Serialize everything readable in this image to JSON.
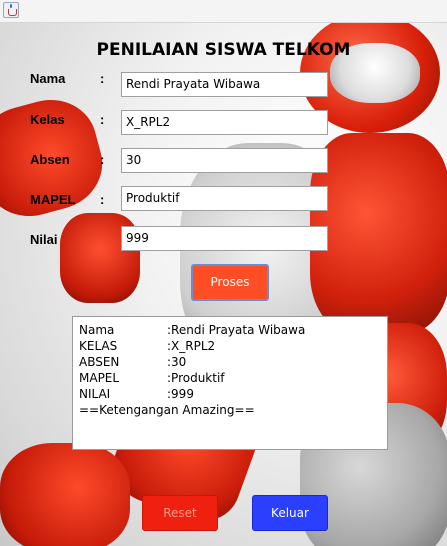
{
  "window": {
    "icon": "java-cup-icon"
  },
  "form": {
    "title": "PENILAIAN SISWA TELKOM",
    "fields": [
      {
        "label": "Nama",
        "colon": ":",
        "value": "Rendi Prayata Wibawa"
      },
      {
        "label": "Kelas",
        "colon": ":",
        "value": "X_RPL2"
      },
      {
        "label": "Absen",
        "colon": ":",
        "value": "30"
      },
      {
        "label": "MAPEL",
        "colon": ":",
        "value": "Produktif"
      },
      {
        "label": "Nilai",
        "colon": "",
        "value": "999"
      }
    ]
  },
  "buttons": {
    "proses": "Proses",
    "reset": "Reset",
    "keluar": "Keluar"
  },
  "output": {
    "rows": [
      {
        "key": "Nama",
        "value": ":Rendi Prayata Wibawa"
      },
      {
        "key": "KELAS",
        "value": ":X_RPL2"
      },
      {
        "key": "ABSEN",
        "value": ":30"
      },
      {
        "key": "MAPEL",
        "value": ":Produktif"
      },
      {
        "key": "NILAI",
        "value": ":999"
      }
    ],
    "remark": "==Ketengangan Amazing=="
  },
  "colors": {
    "proses": "#ff4d26",
    "reset": "#f02010",
    "keluar": "#2a3fff"
  }
}
